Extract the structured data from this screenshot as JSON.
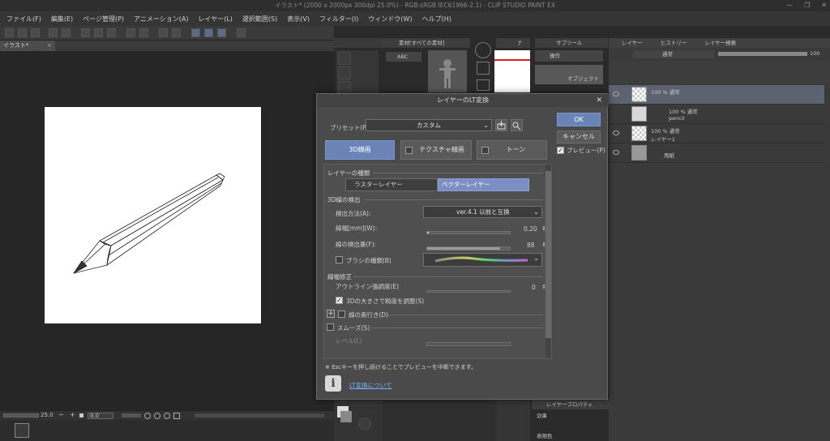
{
  "app": {
    "title": "イラスト* (2000 x 2000px 300dpi 25.0%) - RGB:sRGB IEC61966-2.1) - CLIP STUDIO PAINT EX",
    "window_controls": [
      "—",
      "❐",
      "✕"
    ]
  },
  "menu": [
    "ファイル(F)",
    "編集(E)",
    "ページ管理(P)",
    "アニメーション(A)",
    "レイヤー(L)",
    "選択範囲(S)",
    "表示(V)",
    "フィルター(I)",
    "ウィンドウ(W)",
    "ヘルプ(H)"
  ],
  "document_tab": {
    "label": "イラスト*",
    "close": "×"
  },
  "status": {
    "zoom": "25.0",
    "minus": "−",
    "plus": "+",
    "angle": "0.0"
  },
  "panels": {
    "material_tab": "素材[すべての素材]",
    "material_search": "ABC",
    "navigator_tab": "ナ",
    "subtool_tab": "サブツール",
    "subtool_items": [
      "操作",
      "オブジェクト"
    ],
    "layer_tabs": [
      "レイヤー",
      "ヒストリー",
      "レイヤー検索"
    ],
    "blend_mode": "通常",
    "opacity": "100",
    "layer_property_tab": "レイヤープロパティ",
    "layer_property_effect": "効果",
    "layer_property_color": "表現色"
  },
  "layers": [
    {
      "blend": "100 % 通常",
      "name": "",
      "selected": true
    },
    {
      "blend": "100 % 通常",
      "name": "pencil",
      "selected": false
    },
    {
      "blend": "100 % 通常",
      "name": "レイヤー1",
      "selected": false
    },
    {
      "blend": "",
      "name": "用紙",
      "selected": false
    }
  ],
  "dialog": {
    "title": "レイヤーのLT変換",
    "close": "✕",
    "preset_label": "プリセット(P):",
    "preset_value": "カスタム",
    "ok": "OK",
    "cancel": "キャンセル",
    "preview": "プレビュー(P)",
    "preview_checked": true,
    "mode_tabs": [
      "3D線画",
      "テクスチャ線画",
      "トーン"
    ],
    "active_mode": "3D線画",
    "layer_type_header": "レイヤーの種類",
    "layer_types": [
      "ラスターレイヤー",
      "ベクターレイヤー"
    ],
    "active_layer_type": "ベクターレイヤー",
    "line_detect_header": "3D線の検出",
    "detect_method_label": "検出方法(A):",
    "detect_method_value": "ver.4.1 以前と互換",
    "line_width_label": "線幅[mm](W):",
    "line_width_value": "0.20",
    "detect_amount_label": "線の検出量(F):",
    "detect_amount_value": "88",
    "detect_amount_level": 0.88,
    "brush_type_label": "ブラシの種類(B)",
    "brush_checked": false,
    "correction_header": "線幅修正",
    "outline_label": "アウトライン強調度(E)",
    "outline_value": "0",
    "adjust_3d_label": "3Dの大きさで精度を調整(S)",
    "adjust_3d_checked": true,
    "depth_label": "線の奥行き(D)",
    "depth_expand": "+",
    "smooth_label": "スムーズ(S)",
    "level_label": "レベル(L)",
    "note": "※ Escキーを押し続けることでプレビューを中断できます。",
    "info_icon": "i",
    "link": "LT変換について"
  },
  "colors": {
    "accent": "#6a84b8",
    "dialog_bg": "#4a4a4a",
    "app_bg": "#2b2b2b",
    "selected_layer": "#5d6270"
  }
}
